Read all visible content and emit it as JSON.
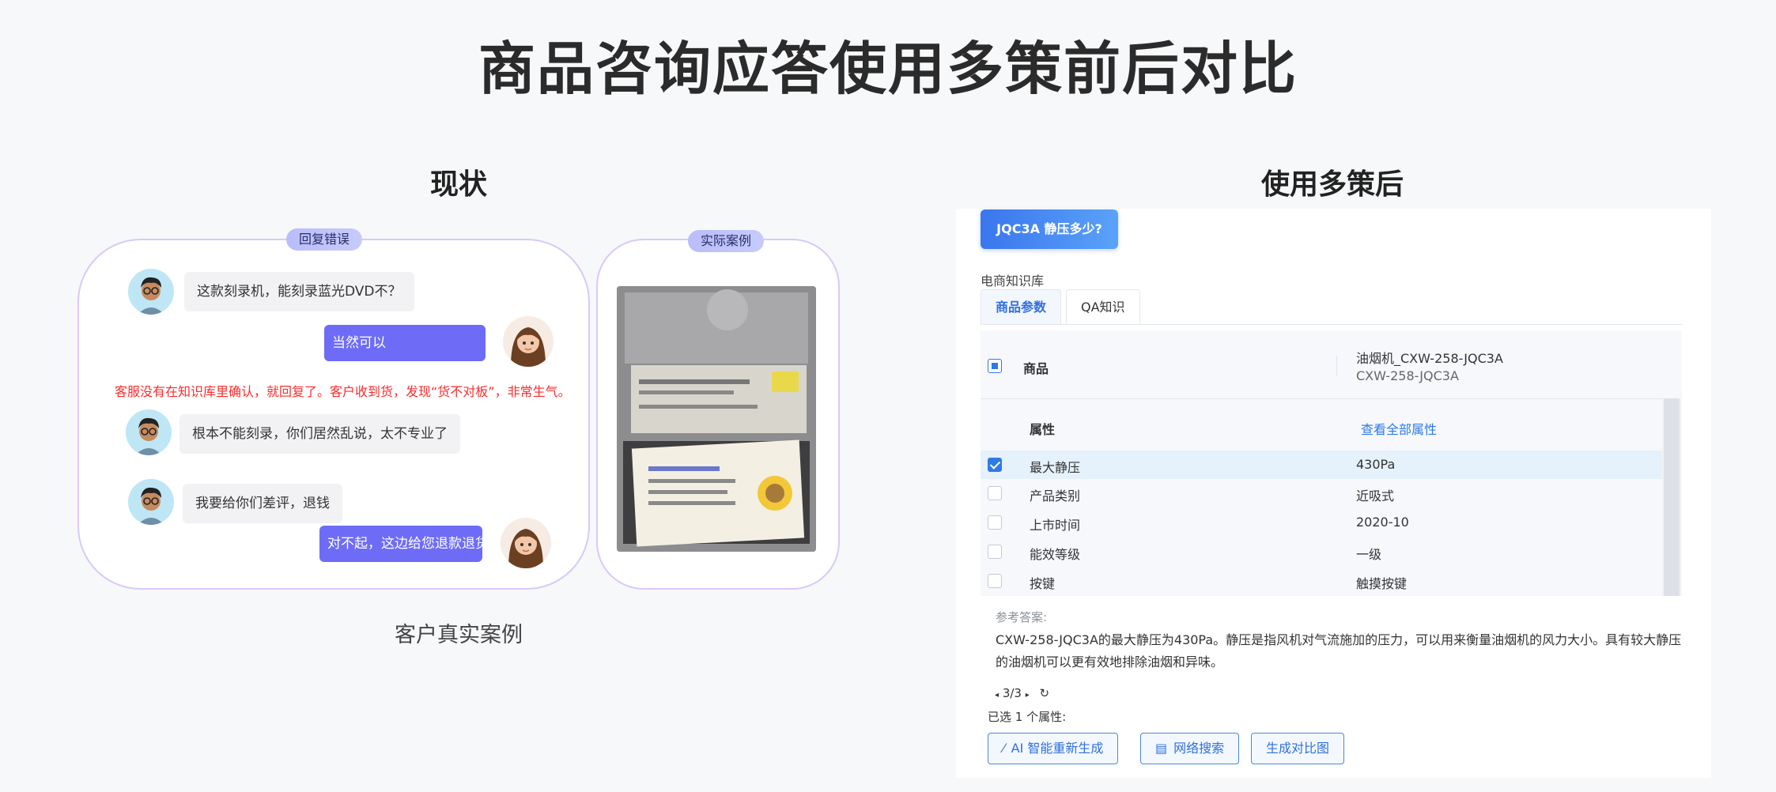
{
  "title": "商品咨询应答使用多策前后对比",
  "left": {
    "section_title": "现状",
    "chat_tag": "回复错误",
    "case_tag": "实际案例",
    "messages": {
      "m1": "这款刻录机，能刻录蓝光DVD不？",
      "m2": "当然可以",
      "m3": "根本不能刻录，你们居然乱说，太不专业了",
      "m4": "我要给你们差评，退钱",
      "m5": "对不起，这边给您退款退货"
    },
    "warning": "客服没有在知识库里确认，就回复了。客户收到货，发现“货不对板”，非常生气。",
    "caption": "客户真实案例"
  },
  "right": {
    "section_title": "使用多策后",
    "query": "JQC3A 静压多少?",
    "kb_label": "电商知识库",
    "tabs": [
      "商品参数",
      "QA知识"
    ],
    "product_label": "商品",
    "product_name": "油烟机_CXW-258-JQC3A",
    "product_model": "CXW-258-JQC3A",
    "attr_header": "属性",
    "view_all": "查看全部属性",
    "rows": [
      {
        "name": "最大静压",
        "value": "430Pa"
      },
      {
        "name": "产品类别",
        "value": "近吸式"
      },
      {
        "name": "上市时间",
        "value": "2020-10"
      },
      {
        "name": "能效等级",
        "value": "一级"
      },
      {
        "name": "按键",
        "value": "触摸按键"
      }
    ],
    "ref_label": "参考答案:",
    "ref_text": "CXW-258-JQC3A的最大静压为430Pa。静压是指风机对气流施加的压力，可以用来衡量油烟机的风力大小。具有较大静压的油烟机可以更有效地排除油烟和异味。",
    "pager": "3/3",
    "selected_info": "已选 1 个属性:",
    "buttons": {
      "regen": "AI 智能重新生成",
      "search": "网络搜索",
      "compare": "生成对比图"
    }
  }
}
